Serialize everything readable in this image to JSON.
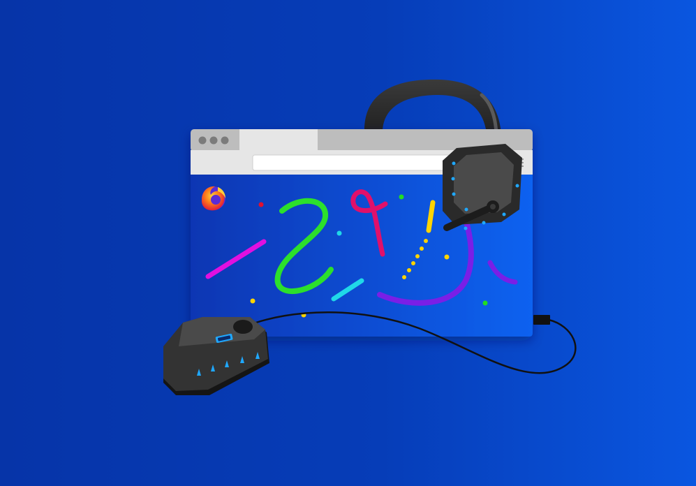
{
  "scene": {
    "description_role": "illustration",
    "browser": {
      "tab_count": 1,
      "window_dots": 3,
      "logo_icon": "firefox-logo-icon"
    },
    "colors": {
      "background_left": "#0634a8",
      "background_right": "#0a56e0",
      "browser_chrome": "#e6e6e6",
      "browser_tabbar": "#bdbdbd",
      "viewport_left": "#0a36b3",
      "viewport_right": "#0b62f0",
      "device_body": "#2e2e2e",
      "device_lights": "#1fa8ff"
    },
    "confetti_colors": [
      "#ff00d4",
      "#22dd22",
      "#e0106a",
      "#ffd400",
      "#20d8e8",
      "#7a1fe6",
      "#e01030"
    ],
    "devices": [
      "headset-icon",
      "gaming-mouse-icon"
    ]
  }
}
